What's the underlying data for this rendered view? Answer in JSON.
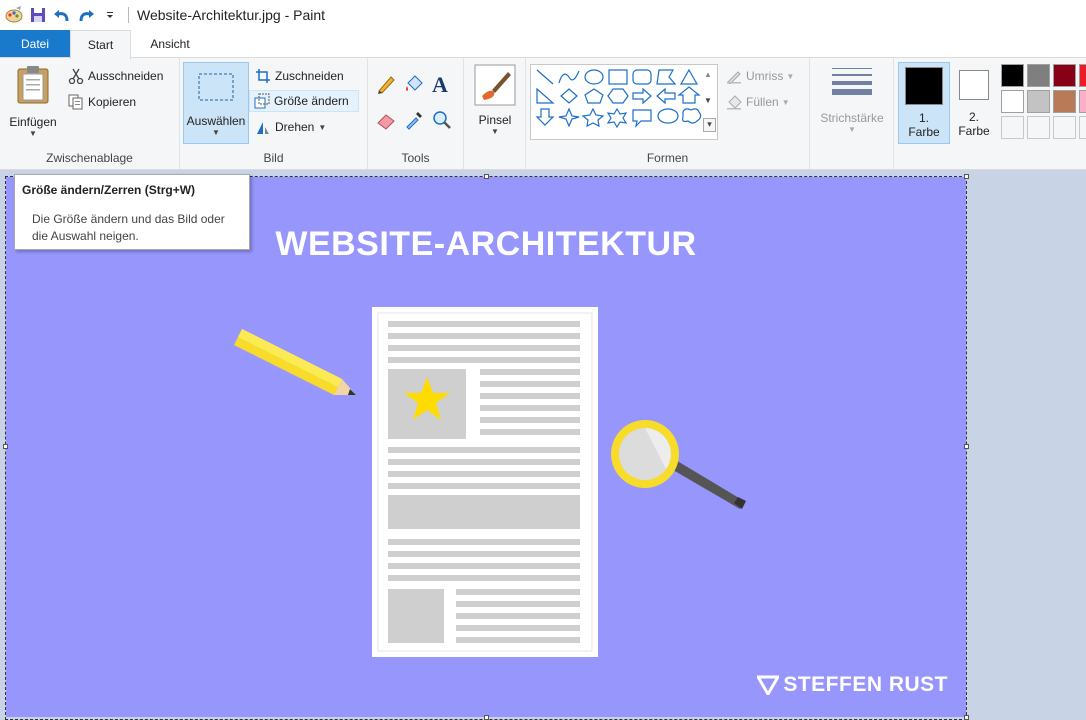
{
  "window": {
    "title": "Website-Architektur.jpg - Paint"
  },
  "quick_access": {
    "icons": [
      "paint-app-icon",
      "save-icon",
      "undo-icon",
      "redo-icon",
      "customize-icon"
    ]
  },
  "tabs": {
    "file": "Datei",
    "home": "Start",
    "view": "Ansicht"
  },
  "clipboard": {
    "paste": "Einfügen",
    "cut": "Ausschneiden",
    "copy": "Kopieren",
    "label": "Zwischenablage"
  },
  "image_group": {
    "select": "Auswählen",
    "crop": "Zuschneiden",
    "resize": "Größe ändern",
    "rotate": "Drehen",
    "label": "Bild"
  },
  "tools": {
    "label": "Tools"
  },
  "brushes": {
    "label": "Pinsel"
  },
  "shapes": {
    "outline": "Umriss",
    "fill": "Füllen",
    "label": "Formen"
  },
  "stroke": {
    "label": "Strichstärke"
  },
  "colors": {
    "color1": "1. Farbe",
    "color1_line1": "1.",
    "color1_line2": "Farbe",
    "color2_line1": "2.",
    "color2_line2": "Farbe",
    "primary": "#000000",
    "secondary": "#ffffff",
    "palette": [
      "#000000",
      "#7f7f7f",
      "#880015",
      "#ed1c24",
      "#ffffff",
      "#c3c3c3",
      "#b97a57",
      "#ffaec9",
      "#ffffff",
      "#ffffff",
      "#ffffff",
      "#ffffff"
    ]
  },
  "tooltip": {
    "title": "Größe ändern/Zerren (Strg+W)",
    "description": "Die Größe ändern und das Bild oder die Auswahl neigen."
  },
  "image": {
    "title": "WEBSITE-ARCHITEKTUR",
    "brand": "STEFFEN RUST",
    "background": "#9696fd"
  }
}
